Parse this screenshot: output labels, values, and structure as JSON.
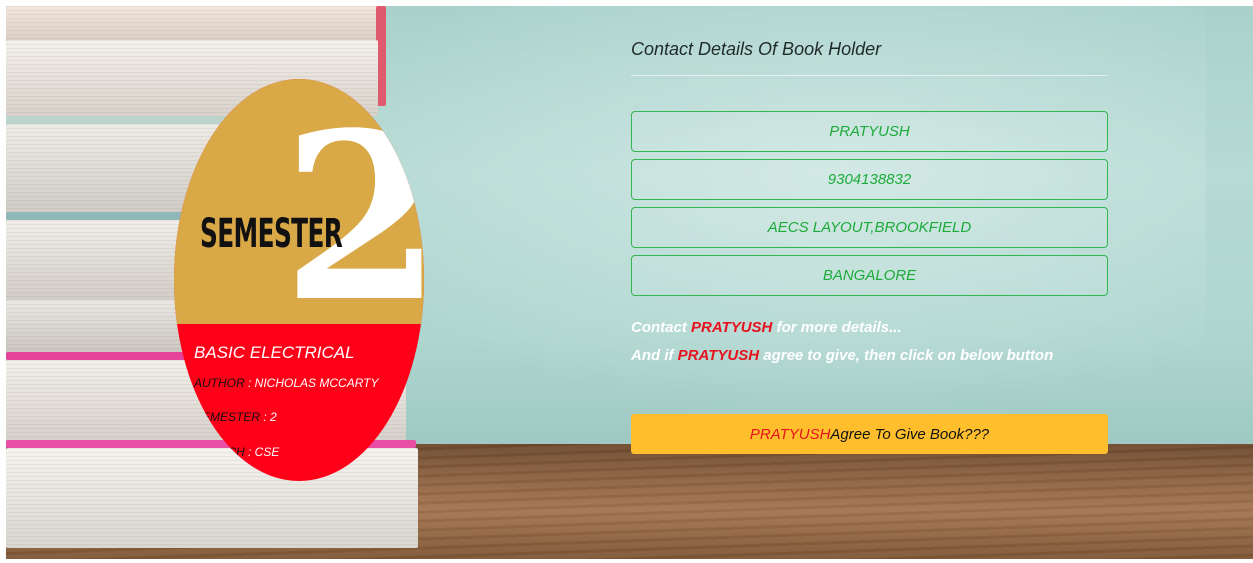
{
  "book": {
    "cover_label": "SEMESTER",
    "cover_number": "2",
    "title": "BASIC ELECTRICAL",
    "author_key": "AUTHOR",
    "author_value": ": NICHOLAS MCCARTY",
    "semester_key": "SEMESTER",
    "semester_value": ": 2",
    "branch_key": "BRANCH",
    "branch_value": ": CSE"
  },
  "contact": {
    "heading": "Contact Details Of Book Holder",
    "name": "PRATYUSH",
    "phone": "9304138832",
    "address": "AECS LAYOUT,BROOKFIELD",
    "city": "BANGALORE"
  },
  "message": {
    "line1_prefix": "Contact ",
    "line1_name": "PRATYUSH",
    "line1_suffix": " for more details...",
    "line2_prefix": "And if ",
    "line2_name": "PRATYUSH",
    "line2_suffix": " agree to give, then click on below button"
  },
  "agree_button": {
    "name": "PRATYUSH",
    "label": " Agree To Give Book???"
  },
  "colors": {
    "accent_green": "#1cab3a",
    "highlight_red": "#e8121e",
    "button_yellow": "#ffbf2c",
    "card_red": "#ff0019",
    "cover_gold": "#d9a847"
  }
}
